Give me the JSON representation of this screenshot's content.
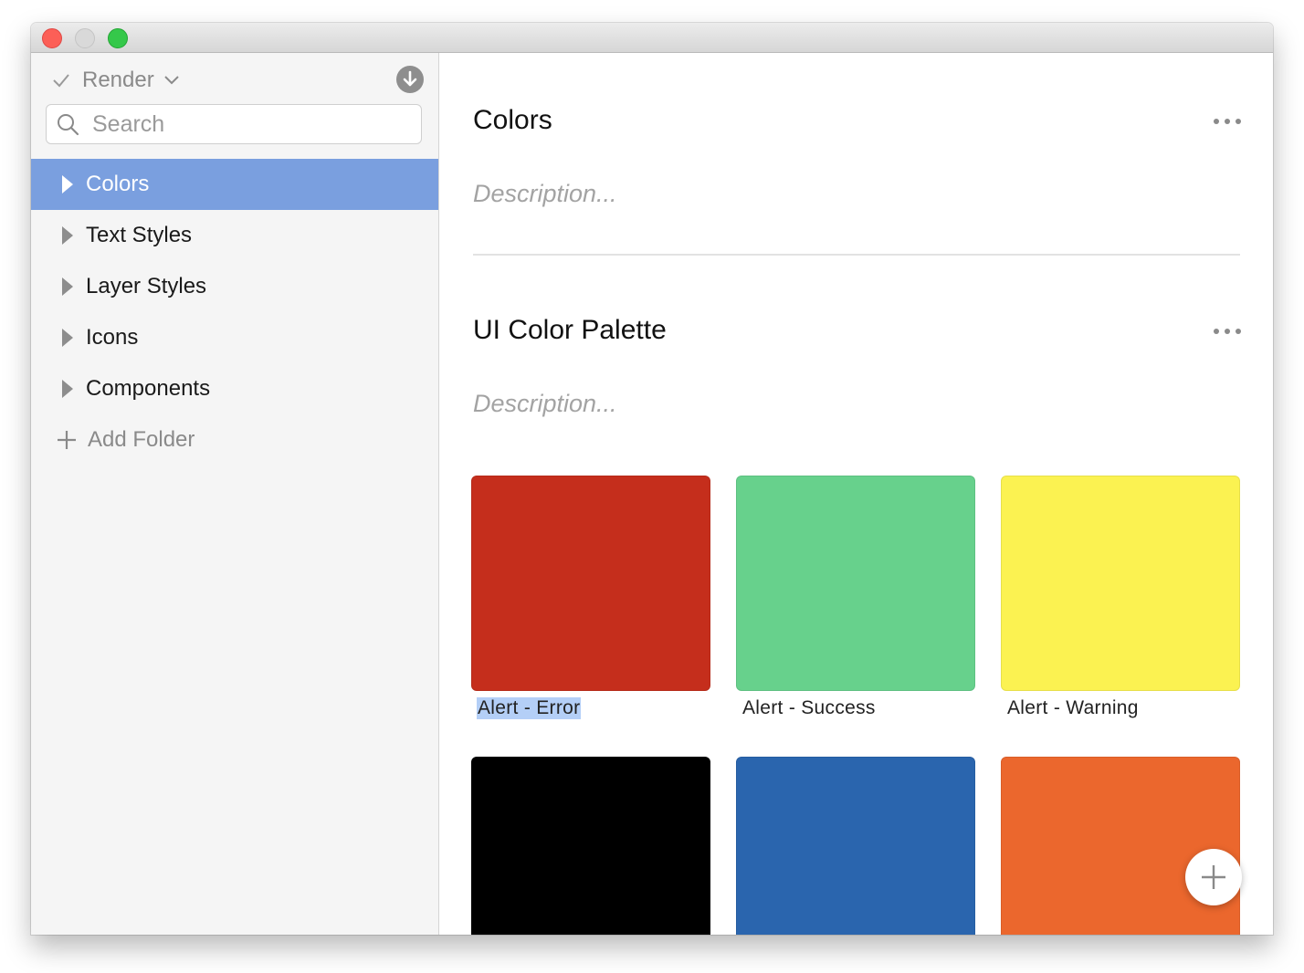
{
  "window": {
    "traffic_lights": {
      "close_color": "#fc5f57",
      "minimize_color": "#d9d9d9",
      "maximize_color": "#35c84a"
    }
  },
  "sidebar": {
    "library_name": "Render",
    "search": {
      "placeholder": "Search",
      "value": ""
    },
    "items": [
      {
        "label": "Colors",
        "selected": true
      },
      {
        "label": "Text Styles",
        "selected": false
      },
      {
        "label": "Layer Styles",
        "selected": false
      },
      {
        "label": "Icons",
        "selected": false
      },
      {
        "label": "Components",
        "selected": false
      }
    ],
    "add_folder_label": "Add Folder",
    "selection_color": "#7a9fdf"
  },
  "main": {
    "sections": [
      {
        "title": "Colors",
        "description_placeholder": "Description..."
      },
      {
        "title": "UI Color Palette",
        "description_placeholder": "Description..."
      }
    ],
    "swatches": [
      {
        "label": "Alert - Error",
        "color": "#c52e1c"
      },
      {
        "label": "Alert - Success",
        "color": "#67d18c"
      },
      {
        "label": "Alert - Warning",
        "color": "#fbf251"
      },
      {
        "label": "",
        "color": "#000000"
      },
      {
        "label": "",
        "color": "#2a65ae"
      },
      {
        "label": "",
        "color": "#eb672d"
      }
    ]
  }
}
